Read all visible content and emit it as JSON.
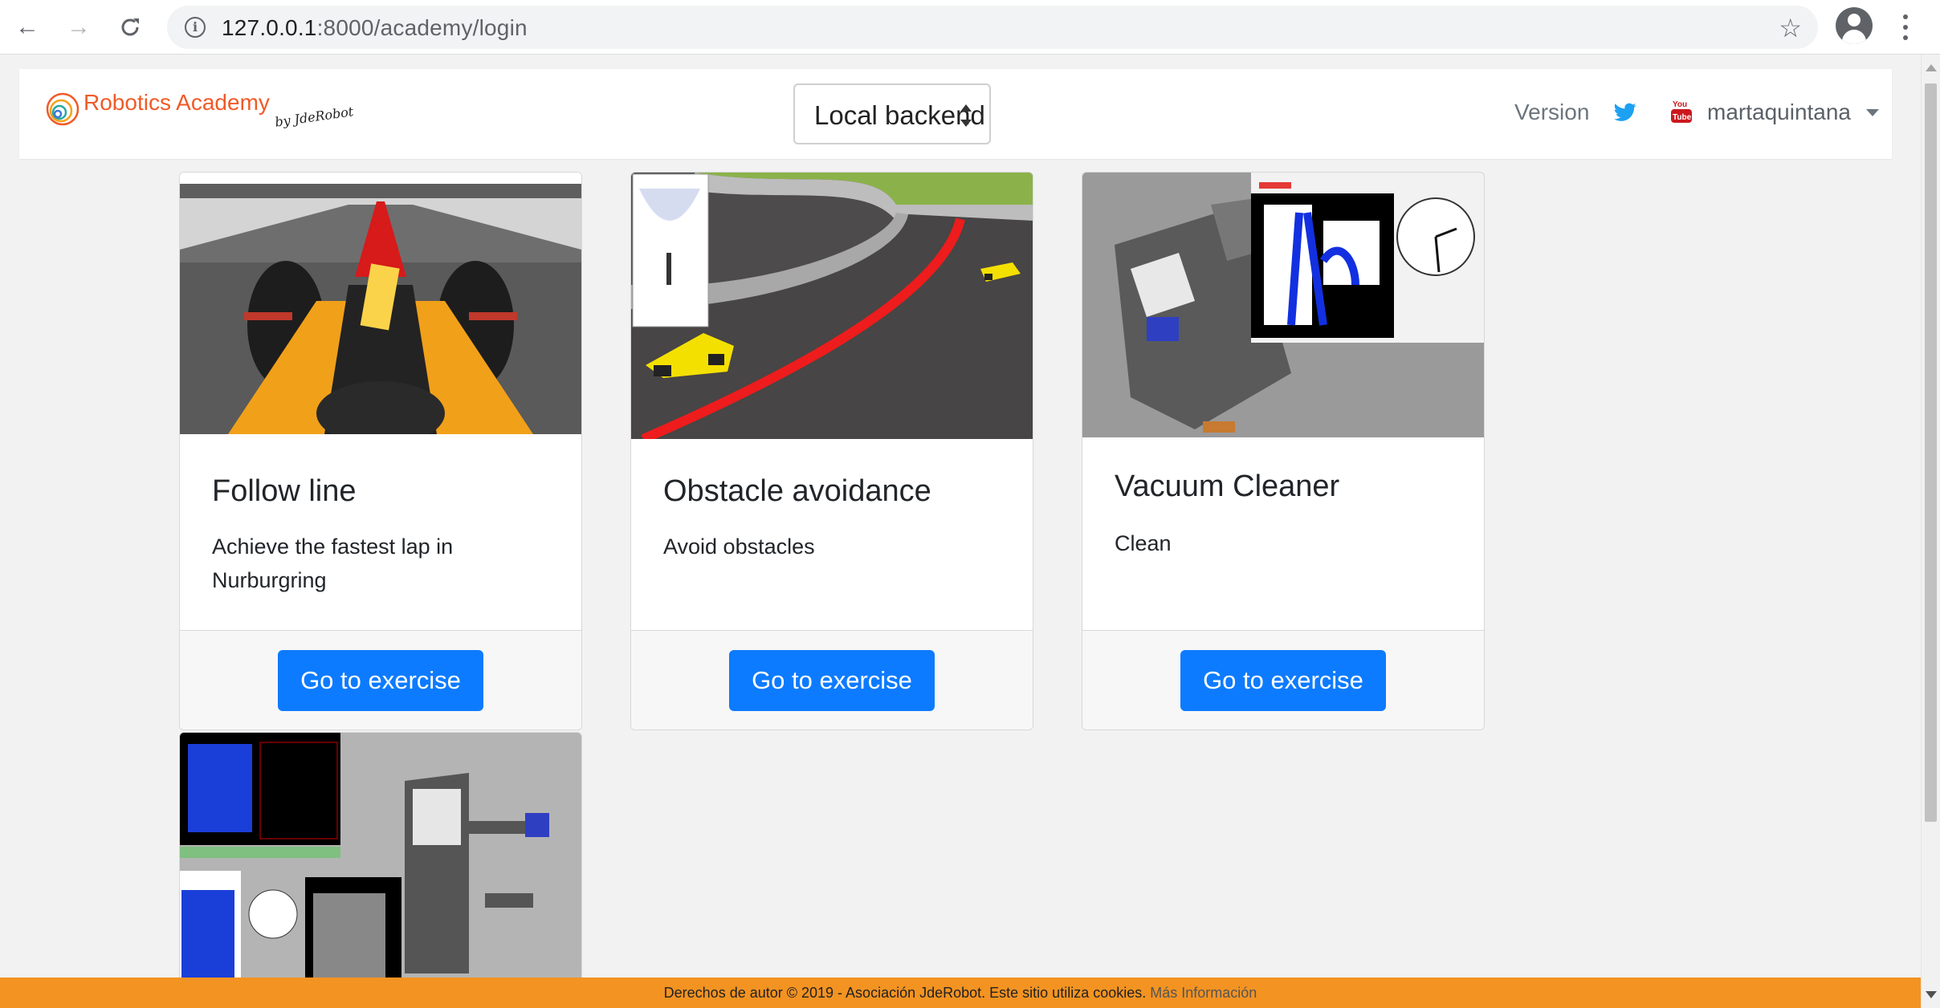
{
  "browser": {
    "url_host": "127.0.0.1",
    "url_path": ":8000/academy/login"
  },
  "header": {
    "brand_name": "Robotics Academy",
    "brand_by": "by JdeRobot",
    "backend_selected": "Local backend",
    "version_label": "Version",
    "user_name": "martaquintana",
    "youtube_label": "You Tube"
  },
  "exercises": [
    {
      "title": "Follow line",
      "description": "Achieve the fastest lap in Nurburgring",
      "button": "Go to exercise"
    },
    {
      "title": "Obstacle avoidance",
      "description": "Avoid obstacles",
      "button": "Go to exercise"
    },
    {
      "title": "Vacuum Cleaner",
      "description": "Clean",
      "button": "Go to exercise"
    }
  ],
  "cookie_bar": {
    "text": "Derechos de autor © 2019 - Asociación JdeRobot. Este sitio utiliza cookies.",
    "link": "Más Información"
  },
  "colors": {
    "brand": "#f05a28",
    "button": "#0d7bff",
    "cookie_bar": "#f39322"
  }
}
